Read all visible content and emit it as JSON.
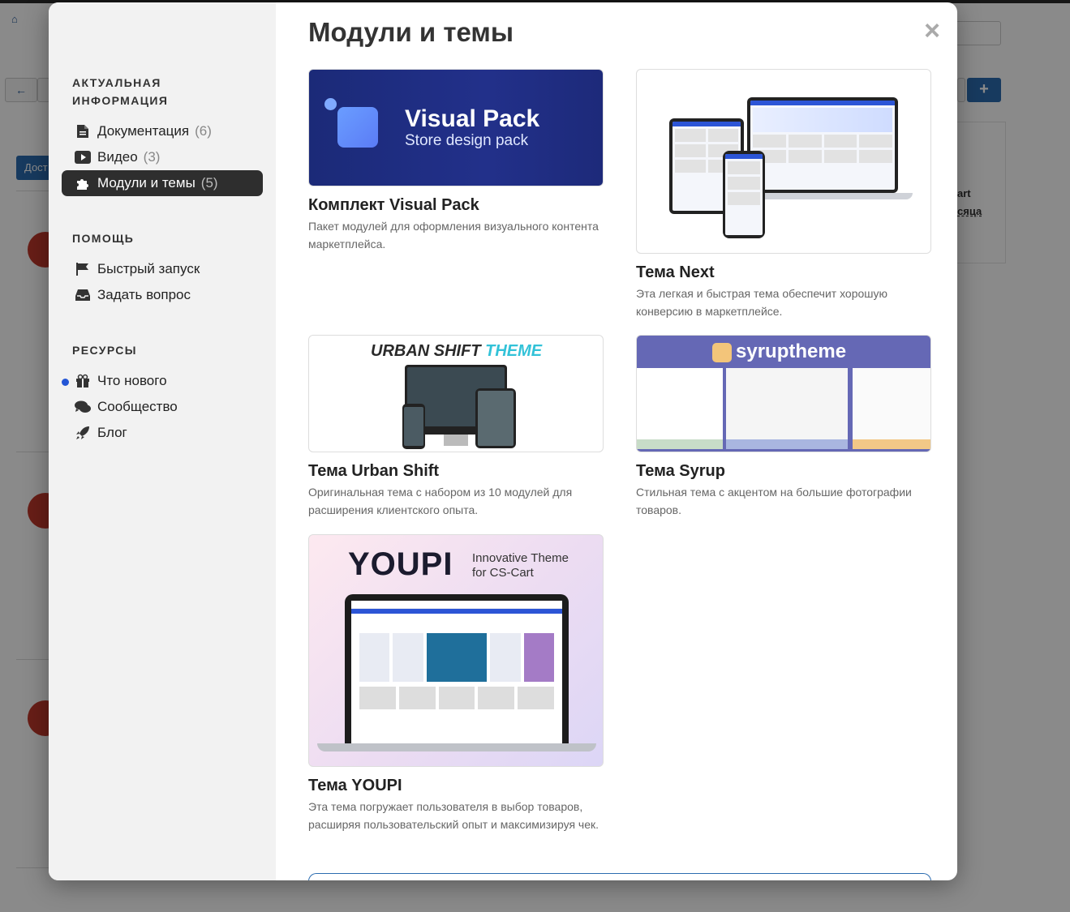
{
  "modal": {
    "title": "Модули и темы",
    "close_label": "×"
  },
  "sidebar": {
    "sections": [
      {
        "title": "АКТУАЛЬНАЯ ИНФОРМАЦИЯ"
      },
      {
        "title": "ПОМОЩЬ"
      },
      {
        "title": "РЕСУРСЫ"
      }
    ],
    "info_items": [
      {
        "label": "Документация",
        "count": "(6)",
        "icon": "file-icon"
      },
      {
        "label": "Видео",
        "count": "(3)",
        "icon": "play-icon"
      },
      {
        "label": "Модули и темы",
        "count": "(5)",
        "icon": "puzzle-icon"
      }
    ],
    "help_items": [
      {
        "label": "Быстрый запуск",
        "icon": "flag-icon"
      },
      {
        "label": "Задать вопрос",
        "icon": "inbox-icon"
      }
    ],
    "resource_items": [
      {
        "label": "Что нового",
        "icon": "gift-icon"
      },
      {
        "label": "Сообщество",
        "icon": "comments-icon"
      },
      {
        "label": "Блог",
        "icon": "rocket-icon"
      }
    ],
    "accent_color": "#2456d6"
  },
  "cards": [
    {
      "title": "Комплект Visual Pack",
      "description": "Пакет модулей для оформления визуального контента маркетплейса.",
      "thumb_text_1": "Visual Pack",
      "thumb_text_2": "Store design pack"
    },
    {
      "title": "Тема Next",
      "description": "Эта легкая и быстрая тема обеспечит хорошую конверсию в маркетплейсе."
    },
    {
      "title": "Тема Urban Shift",
      "description": "Оригинальная тема с набором из 10 модулей для расширения клиентского опыта.",
      "thumb_text_1": "URBAN SHIFT",
      "thumb_text_2": "THEME"
    },
    {
      "title": "Тема Syrup",
      "description": "Стильная тема с акцентом на большие фотографии товаров.",
      "thumb_text_1": "syruptheme"
    },
    {
      "title": "Тема YOUPI",
      "description": "Эта тема погружает пользователя в выбор товаров, расширяя пользовательский опыт и максимизируя чек.",
      "thumb_text_1": "YOUPI",
      "thumb_text_2": "Innovative Theme for CS-Cart"
    }
  ],
  "background": {
    "tab_label": "Дост",
    "side_text_1": "art",
    "side_text_2": "сяца"
  }
}
